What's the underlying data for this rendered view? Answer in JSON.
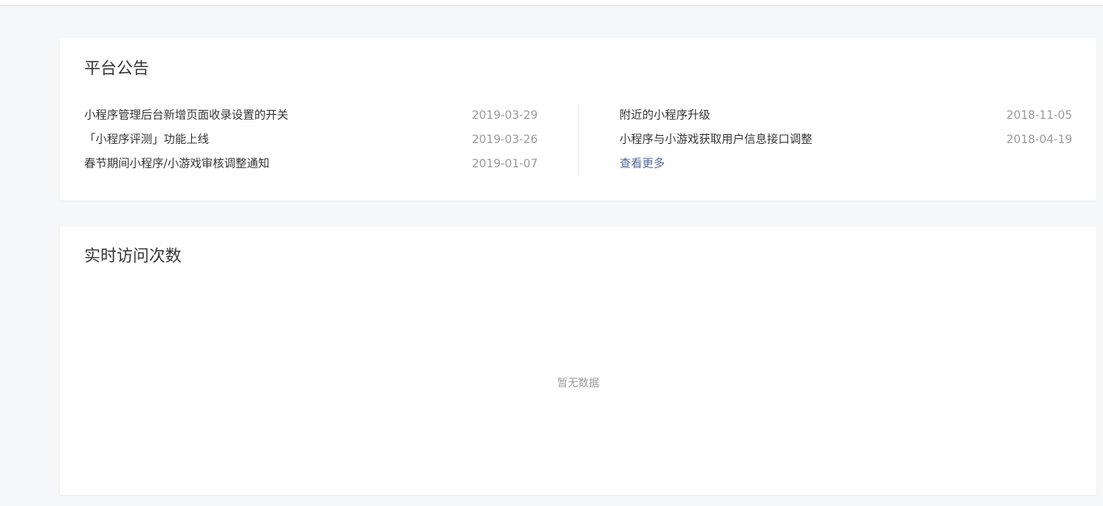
{
  "notice": {
    "title": "平台公告",
    "left_items": [
      {
        "title": "小程序管理后台新增页面收录设置的开关",
        "date": "2019-03-29"
      },
      {
        "title": "「小程序评测」功能上线",
        "date": "2019-03-26"
      },
      {
        "title": "春节期间小程序/小游戏审核调整通知",
        "date": "2019-01-07"
      }
    ],
    "right_items": [
      {
        "title": "附近的小程序升级",
        "date": "2018-11-05"
      },
      {
        "title": "小程序与小游戏获取用户信息接口调整",
        "date": "2018-04-19"
      }
    ],
    "more_label": "查看更多"
  },
  "visits": {
    "title": "实时访问次数",
    "empty_text": "暂无数据"
  },
  "colors": {
    "background": "#f6f7f9",
    "card": "#ffffff",
    "text": "#353535",
    "muted": "#9a9a9a",
    "link": "#576b95"
  }
}
